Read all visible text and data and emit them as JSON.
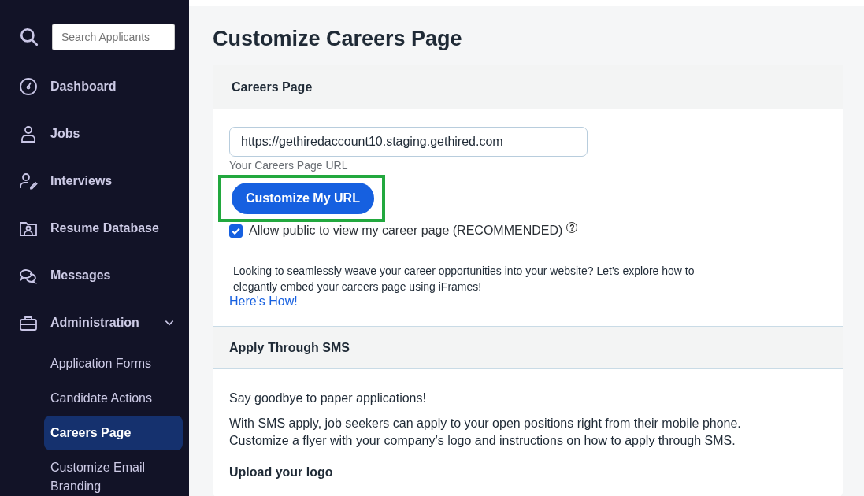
{
  "sidebar": {
    "search": {
      "placeholder": "Search Applicants"
    },
    "items": [
      {
        "label": "Dashboard",
        "selected": false
      },
      {
        "label": "Jobs",
        "selected": false
      },
      {
        "label": "Interviews",
        "selected": false
      },
      {
        "label": "Resume Database",
        "selected": false
      },
      {
        "label": "Messages",
        "selected": false
      },
      {
        "label": "Administration",
        "selected": false,
        "expanded": true,
        "children": [
          {
            "label": "Application Forms",
            "selected": false
          },
          {
            "label": "Candidate Actions",
            "selected": false
          },
          {
            "label": "Careers Page",
            "selected": true
          },
          {
            "label": "Customize Email Branding",
            "selected": false
          }
        ]
      }
    ]
  },
  "page_title": "Customize Careers Page",
  "careers_section": {
    "heading": "Careers Page",
    "url_field": {
      "value": "https://gethiredaccount10.staging.gethired.com",
      "caption": "Your Careers Page URL"
    },
    "button": "Customize My URL",
    "button_highlighted": true,
    "public_checkbox": {
      "label": "Allow public to view my career page (RECOMMENDED)",
      "checked": true
    },
    "help_icon": "?",
    "embed_text": "Looking to seamlessly weave your career opportunities into your website? Let's explore how to elegantly embed your careers page using iFrames!",
    "link": "Here's How!"
  },
  "sms_section": {
    "heading": "Apply Through SMS",
    "paragraphs": [
      "Say goodbye to paper applications!",
      "With SMS apply, job seekers can apply to your open positions right from their mobile phone. Customize a flyer with your company’s logo and instructions on how to apply through SMS."
    ],
    "subheading": "Upload your logo"
  }
}
